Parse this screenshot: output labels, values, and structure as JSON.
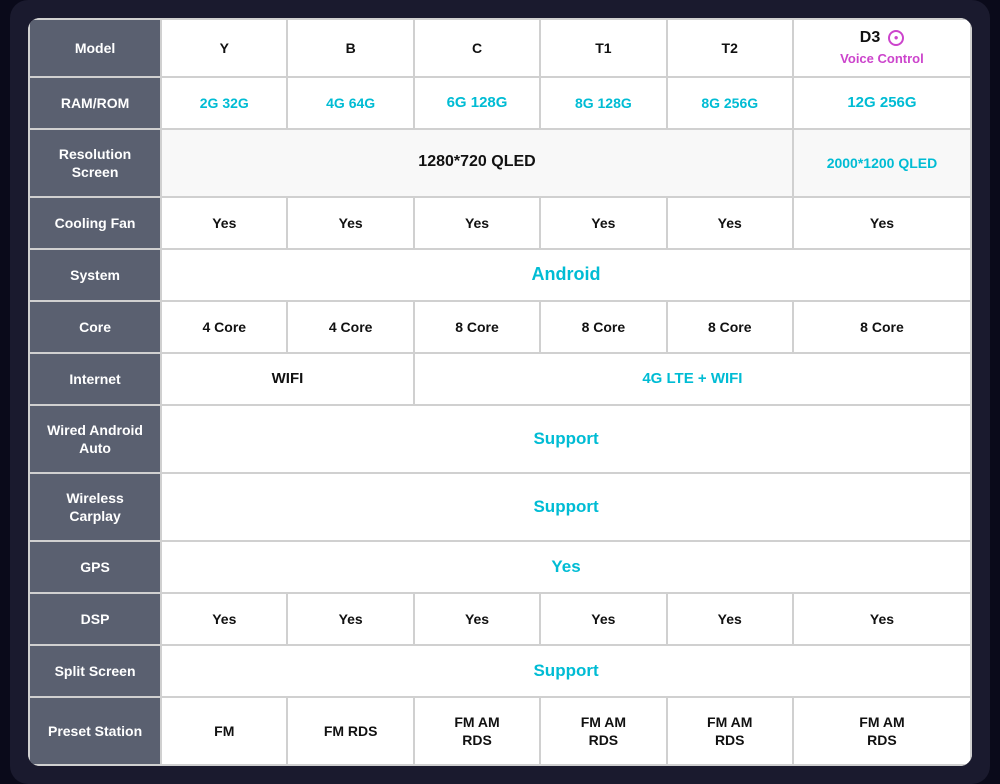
{
  "table": {
    "headers": {
      "model": "Model",
      "ram_rom": "RAM/ROM",
      "resolution": "Resolution\nScreen",
      "cooling_fan": "Cooling Fan",
      "system": "System",
      "core": "Core",
      "internet": "Internet",
      "wired_android": "Wired Android\nAuto",
      "wireless_carplay": "Wireless\nCarplay",
      "gps": "GPS",
      "dsp": "DSP",
      "split_screen": "Split Screen",
      "preset_station": "Preset Station"
    },
    "models": {
      "y": "Y",
      "b": "B",
      "c": "C",
      "t1": "T1",
      "t2": "T2",
      "d3": "D3",
      "d3_voice": "Voice Control"
    },
    "ram": {
      "y": "2G 32G",
      "b": "4G 64G",
      "c": "6G 128G",
      "t1": "8G 128G",
      "t2": "8G 256G",
      "d3": "12G 256G"
    },
    "resolution": {
      "standard": "1280*720 QLED",
      "d3": "2000*1200 QLED"
    },
    "cooling_fan": "Yes",
    "system": "Android",
    "core": {
      "y": "4 Core",
      "b": "4 Core",
      "c": "8 Core",
      "t1": "8 Core",
      "t2": "8 Core",
      "d3": "8 Core"
    },
    "internet": {
      "yb": "WIFI",
      "rest": "4G LTE + WIFI"
    },
    "wired_android": "Support",
    "wireless_carplay": "Support",
    "gps": "Yes",
    "dsp": "Yes",
    "split_screen": "Support",
    "preset": {
      "y": "FM",
      "b": "FM RDS",
      "c": "FM AM\nRDS",
      "t1": "FM AM\nRDS",
      "t2": "FM AM\nRDS",
      "d3": "FM AM\nRDS"
    }
  }
}
